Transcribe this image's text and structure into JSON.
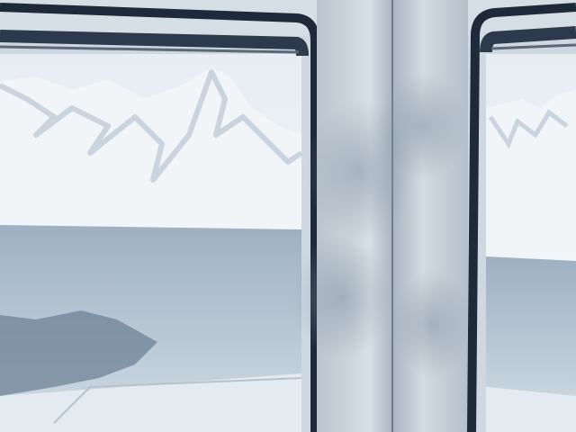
{
  "scene": {
    "description_visible_text": "",
    "colors": {
      "sky": "#eef2f6",
      "snow": "#f4f7fa",
      "mountain_shadow": "#b9c7d4",
      "sea": "#9fb0c0",
      "sea_dark": "#5d7184",
      "ice": "#e6eef4",
      "frame": "#1e2a3a",
      "pillar": "#c9d2da",
      "pillar_shade": "#aab6c1"
    }
  }
}
